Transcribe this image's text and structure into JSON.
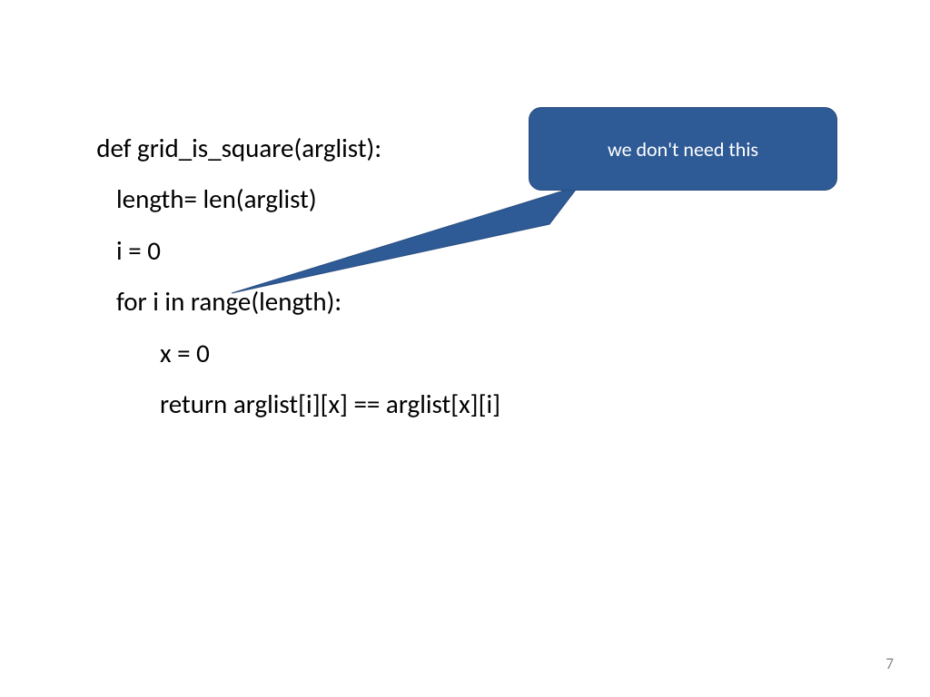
{
  "code": {
    "l1": "def grid_is_square(arglist):",
    "l2": "length= len(arglist)",
    "l3": "i = 0",
    "l4": "for i in range(length):",
    "l5": "x = 0",
    "l6": "return arglist[i][x] == arglist[x][i]"
  },
  "callout": {
    "text": "we don't need this",
    "bg": "#2e5a96"
  },
  "page_number": "7"
}
